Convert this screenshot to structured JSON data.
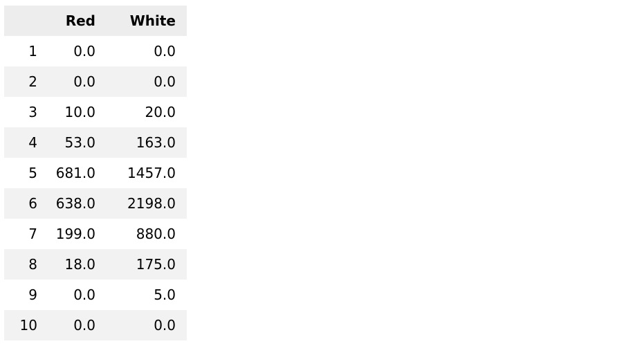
{
  "table": {
    "index_header": "",
    "columns": [
      "Red",
      "White"
    ],
    "rows": [
      {
        "index": "1",
        "Red": "0.0",
        "White": "0.0"
      },
      {
        "index": "2",
        "Red": "0.0",
        "White": "0.0"
      },
      {
        "index": "3",
        "Red": "10.0",
        "White": "20.0"
      },
      {
        "index": "4",
        "Red": "53.0",
        "White": "163.0"
      },
      {
        "index": "5",
        "Red": "681.0",
        "White": "1457.0"
      },
      {
        "index": "6",
        "Red": "638.0",
        "White": "2198.0"
      },
      {
        "index": "7",
        "Red": "199.0",
        "White": "880.0"
      },
      {
        "index": "8",
        "Red": "18.0",
        "White": "175.0"
      },
      {
        "index": "9",
        "Red": "0.0",
        "White": "5.0"
      },
      {
        "index": "10",
        "Red": "0.0",
        "White": "0.0"
      }
    ]
  },
  "colors": {
    "header_bg": "#ededed",
    "stripe_bg": "#f2f2f2",
    "row_bg": "#ffffff",
    "text": "#000000"
  }
}
